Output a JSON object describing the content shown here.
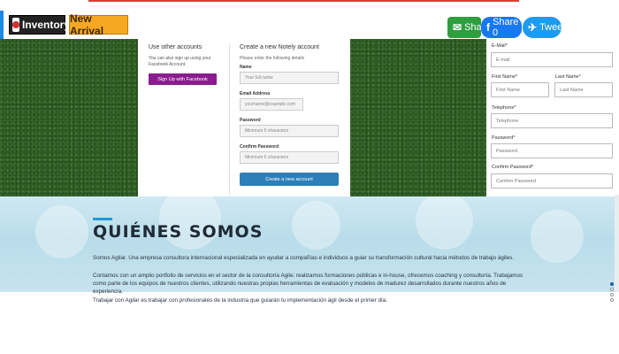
{
  "topbar": {
    "inventory_label": "Inventory",
    "new_arrival_label": "New Arrival"
  },
  "share": {
    "whatsapp_label": "Share",
    "facebook_label": "Share 0",
    "twitter_label": "Tweet"
  },
  "login": {
    "other_heading": "Use other accounts",
    "other_text": "You can also sign up using your Facebook Account.",
    "facebook_button": "Sign Up with Facebook",
    "create_heading": "Create a new Notely account",
    "create_sub": "Please enter the following details",
    "name_label": "Name",
    "name_placeholder": "Your full name",
    "email_label": "Email Address",
    "email_placeholder": "yourname@example.com",
    "password_label": "Password",
    "password_placeholder": "Minimum 6 characters",
    "confirm_label": "Confirm Password",
    "confirm_placeholder": "Minimum 6 characters",
    "create_button": "Create a new account"
  },
  "register": {
    "email_label": "E-Mail*",
    "email_placeholder": "E-mail",
    "first_label": "First Name*",
    "first_placeholder": "First Name",
    "last_label": "Last Name*",
    "last_placeholder": "Last Name",
    "tel_label": "Telephone*",
    "tel_placeholder": "Telephone",
    "pass_label": "Password*",
    "pass_placeholder": "Password",
    "confirm_label": "Confirm Password*",
    "confirm_placeholder": "Confirm Password"
  },
  "about": {
    "title": "QUIÉNES SOMOS",
    "p1": "Somos Agilar. Una empresa consultora internacional especializada en ayudar a compañías e individuos a guiar su transformación cultural hacia métodos de trabajo ágiles.",
    "p2": "Contamos con un amplio portfolio de servicios en el sector de la consultoría Agile: realizamos formaciones públicas e in-house, ofrecemos coaching y consultoría. Trabajamos como parte de los equipos de nuestros clientes, utilizando nuestras propias herramientas de evaluación y modelos de madurez desarrollados durante nuestros años de experiencia.",
    "p3": "Trabajar con Agilar es trabajar con profesionales de la industria que guiarán tu implementación ágil desde el primer día."
  },
  "colors": {
    "facebook_button": "#8a1c8f",
    "create_button": "#2c7fb8",
    "accent": "#1e9bd7"
  }
}
